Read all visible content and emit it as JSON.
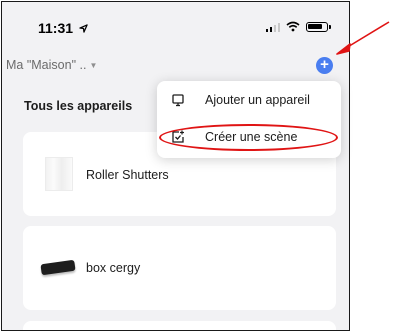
{
  "status_bar": {
    "time": "11:31"
  },
  "header": {
    "home_name": "Ma \"Maison\" ..",
    "add_symbol": "+"
  },
  "section": {
    "title": "Tous les appareils"
  },
  "devices": [
    {
      "label": "Roller Shutters"
    },
    {
      "label": "box cergy"
    }
  ],
  "menu": {
    "items": [
      {
        "label": "Ajouter un appareil"
      },
      {
        "label": "Créer une scène"
      }
    ]
  },
  "colors": {
    "accent": "#4a7ef0",
    "annotation": "#e01414"
  }
}
